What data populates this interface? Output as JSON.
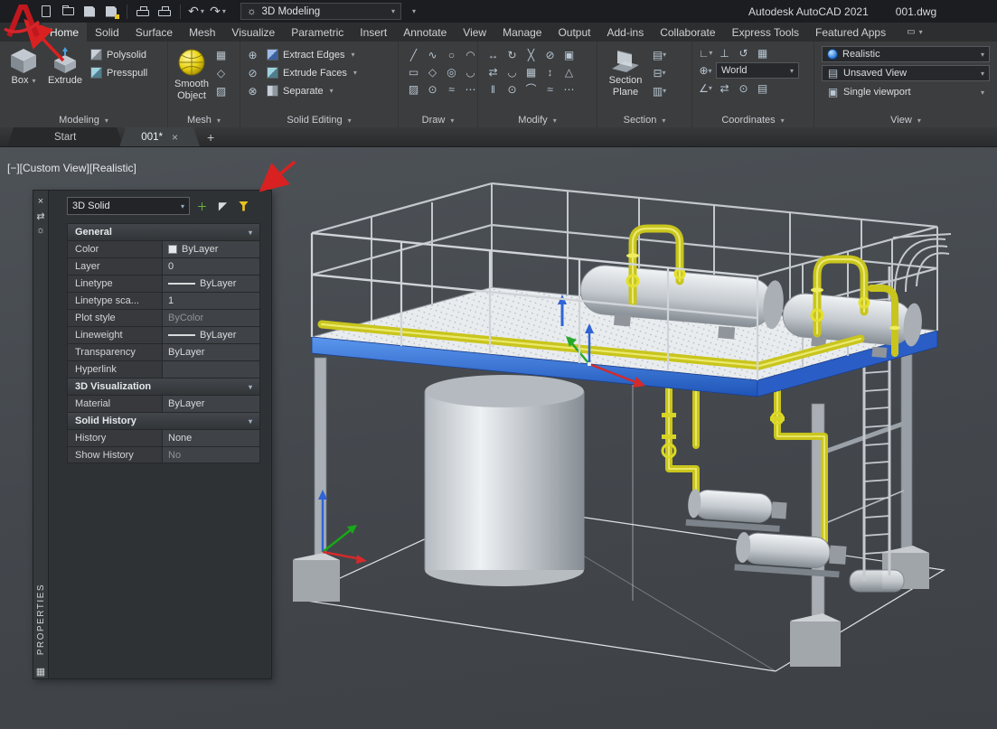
{
  "titlebar": {
    "workspace": "3D Modeling",
    "app_title": "Autodesk AutoCAD 2021",
    "doc_name": "001.dwg"
  },
  "ribbon_tabs": {
    "items": [
      "Home",
      "Solid",
      "Surface",
      "Mesh",
      "Visualize",
      "Parametric",
      "Insert",
      "Annotate",
      "View",
      "Manage",
      "Output",
      "Add-ins",
      "Collaborate",
      "Express Tools",
      "Featured Apps"
    ],
    "active": "Home"
  },
  "ribbon": {
    "modeling": {
      "label": "Modeling",
      "box": "Box",
      "extrude": "Extrude",
      "polysolid": "Polysolid",
      "presspull": "Presspull"
    },
    "mesh": {
      "label": "Mesh",
      "smooth_line1": "Smooth",
      "smooth_line2": "Object"
    },
    "solid_editing": {
      "label": "Solid Editing",
      "extract_edges": "Extract Edges",
      "extrude_faces": "Extrude Faces",
      "separate": "Separate"
    },
    "draw": {
      "label": "Draw"
    },
    "modify": {
      "label": "Modify"
    },
    "section": {
      "label": "Section",
      "plane_line1": "Section",
      "plane_line2": "Plane"
    },
    "coordinates": {
      "label": "Coordinates",
      "world": "World"
    },
    "view": {
      "label": "View",
      "visual_style": "Realistic",
      "named_view": "Unsaved View",
      "viewport_config": "Single viewport"
    }
  },
  "file_tabs": {
    "start": "Start",
    "doc": "001*",
    "close": "×",
    "new_tab": "+"
  },
  "viewport": {
    "label": "[−][Custom View][Realistic]"
  },
  "properties_palette": {
    "title": "PROPERTIES",
    "selector": "3D Solid",
    "sections": [
      {
        "title": "General",
        "rows": [
          {
            "label": "Color",
            "value": "ByLayer"
          },
          {
            "label": "Layer",
            "value": "0"
          },
          {
            "label": "Linetype",
            "value": "ByLayer"
          },
          {
            "label": "Linetype sca...",
            "value": "1"
          },
          {
            "label": "Plot style",
            "value": "ByColor"
          },
          {
            "label": "Lineweight",
            "value": "ByLayer"
          },
          {
            "label": "Transparency",
            "value": "ByLayer"
          },
          {
            "label": "Hyperlink",
            "value": ""
          }
        ]
      },
      {
        "title": "3D Visualization",
        "rows": [
          {
            "label": "Material",
            "value": "ByLayer"
          }
        ]
      },
      {
        "title": "Solid History",
        "rows": [
          {
            "label": "History",
            "value": "None"
          },
          {
            "label": "Show History",
            "value": "No"
          }
        ]
      }
    ]
  },
  "icons": {
    "qat": [
      "new-file",
      "open-file",
      "save",
      "save-as",
      "plot",
      "undo",
      "redo"
    ],
    "palette_toolbar": [
      "pickadd-toggle",
      "select-objects",
      "quick-select"
    ]
  },
  "colors": {
    "annotation_red": "#d92121",
    "deck_blue": "#2f6fd8",
    "pipe_yellow": "#c9c51d",
    "titlebar_bg": "#1c1d20",
    "ribbon_bg": "#3b3d3f"
  }
}
